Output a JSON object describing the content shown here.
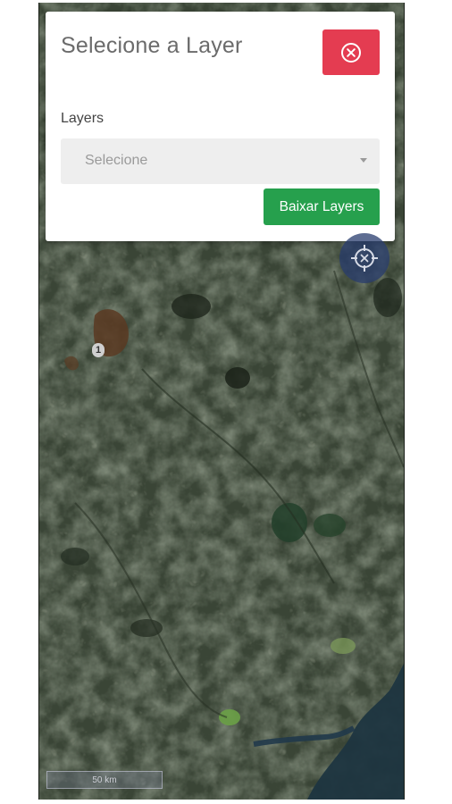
{
  "modal": {
    "title": "Selecione a Layer",
    "close_icon": "close-circle-icon",
    "layers_label": "Layers",
    "select": {
      "selected_text": "Selecione",
      "caret_icon": "caret-down-icon"
    },
    "download_button_label": "Baixar Layers"
  },
  "map": {
    "locate_icon": "crosshair-locate-icon",
    "cluster_count": "1",
    "scale_label": "50 km"
  },
  "colors": {
    "close_button": "#e43c51",
    "download_button": "#26a04d",
    "select_bg": "#eeeeee",
    "locate_button": "#36508c"
  }
}
